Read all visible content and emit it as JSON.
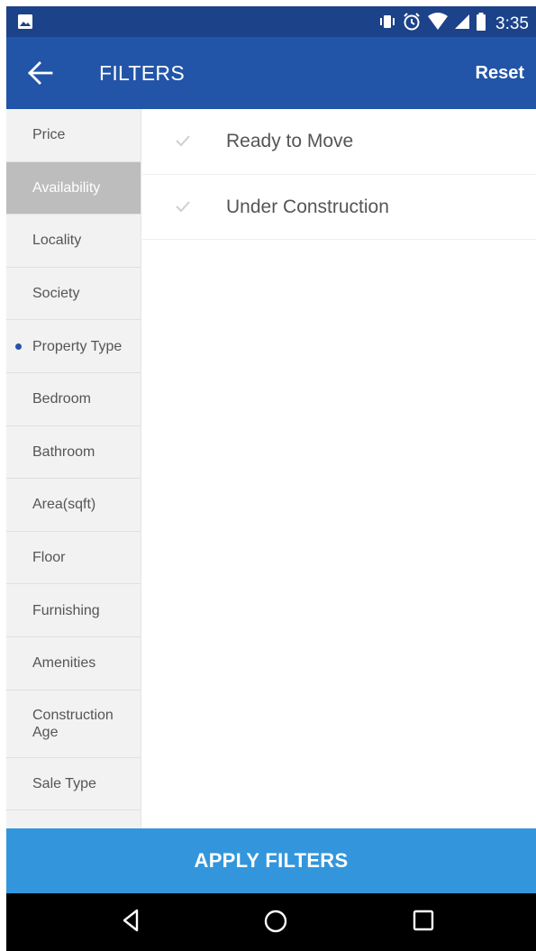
{
  "status_bar": {
    "time": "3:35",
    "icons": [
      "gallery-icon",
      "vibrate-icon",
      "alarm-icon",
      "wifi-icon",
      "signal-icon",
      "battery-icon"
    ]
  },
  "header": {
    "title": "FILTERS",
    "reset_label": "Reset",
    "back_icon": "arrow-left-icon",
    "background": "#2255a8",
    "status_background": "#1c4289"
  },
  "sidebar": {
    "items": [
      {
        "label": "Price",
        "active": false,
        "dot": false
      },
      {
        "label": "Availability",
        "active": true,
        "dot": false
      },
      {
        "label": "Locality",
        "active": false,
        "dot": false
      },
      {
        "label": "Society",
        "active": false,
        "dot": false
      },
      {
        "label": "Property Type",
        "active": false,
        "dot": true
      },
      {
        "label": "Bedroom",
        "active": false,
        "dot": false
      },
      {
        "label": "Bathroom",
        "active": false,
        "dot": false
      },
      {
        "label": "Area(sqft)",
        "active": false,
        "dot": false
      },
      {
        "label": "Floor",
        "active": false,
        "dot": false
      },
      {
        "label": "Furnishing",
        "active": false,
        "dot": false
      },
      {
        "label": "Amenities",
        "active": false,
        "dot": false
      },
      {
        "label": "Construction\nAge",
        "active": false,
        "dot": false
      },
      {
        "label": "Sale Type",
        "active": false,
        "dot": false
      }
    ]
  },
  "options": [
    {
      "label": "Ready to Move",
      "checked": false
    },
    {
      "label": "Under Construction",
      "checked": false
    }
  ],
  "footer": {
    "apply_label": "APPLY FILTERS",
    "color": "#3396dc"
  },
  "nav_bar": {
    "icons": [
      "back-triangle-icon",
      "home-circle-icon",
      "recents-square-icon"
    ]
  }
}
